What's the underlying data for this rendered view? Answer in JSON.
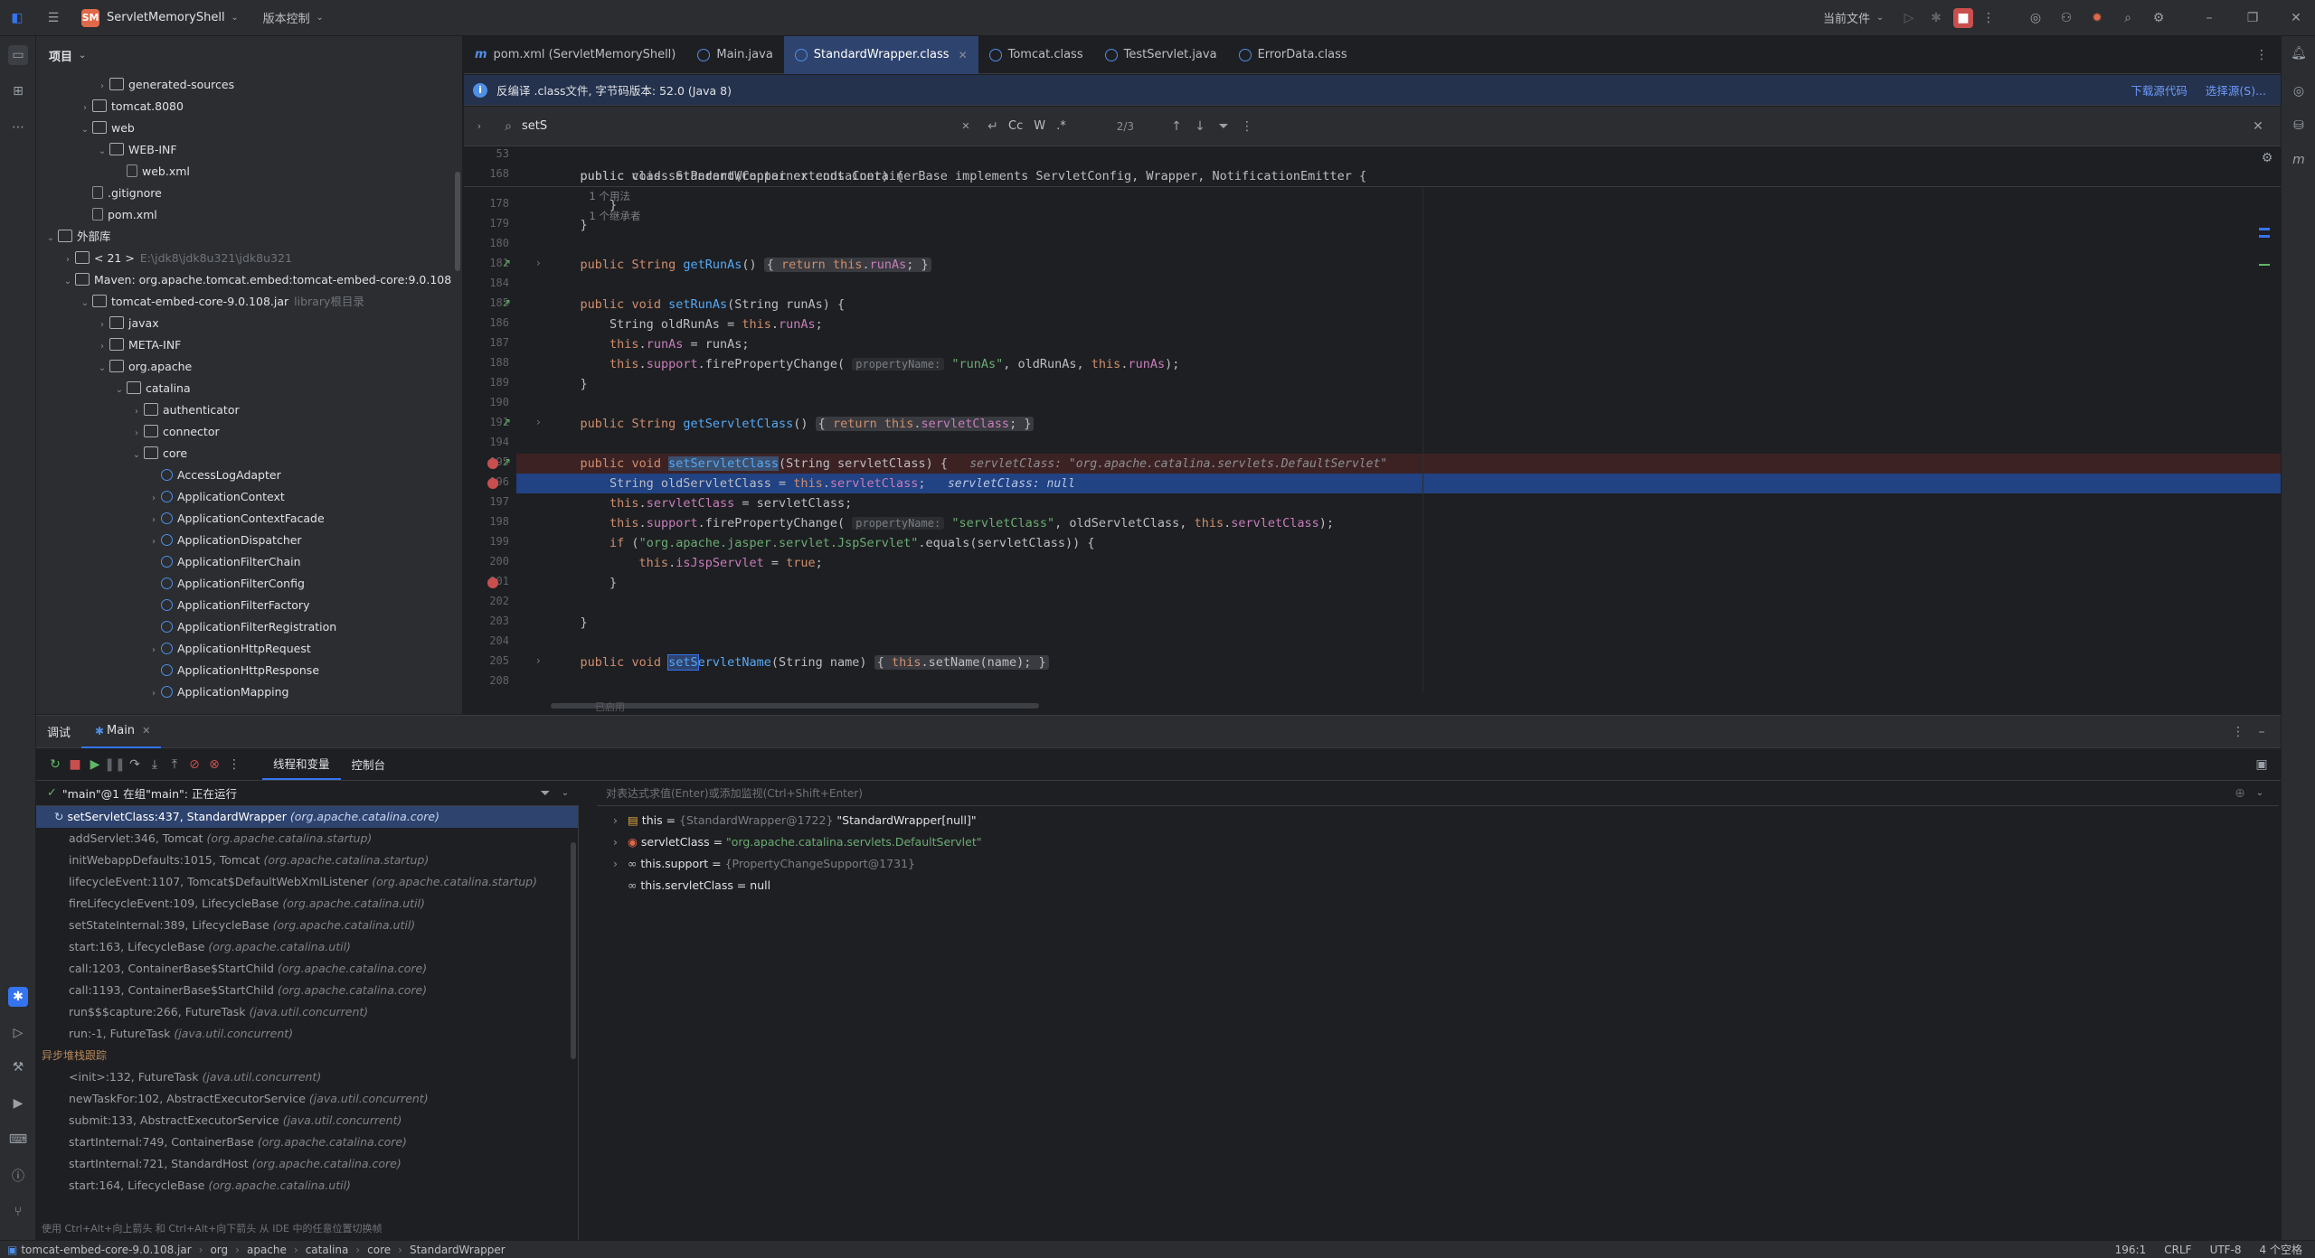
{
  "titlebar": {
    "project_badge": "SM",
    "project_name": "ServletMemoryShell",
    "vcs_label": "版本控制",
    "run_config": "当前文件"
  },
  "project_panel": {
    "title": "项目",
    "items": [
      {
        "label": "generated-sources",
        "depth": 3,
        "type": "folder",
        "arrow": "›"
      },
      {
        "label": "tomcat.8080",
        "depth": 2,
        "type": "folder",
        "arrow": "›"
      },
      {
        "label": "web",
        "depth": 2,
        "type": "folder",
        "arrow": "⌄"
      },
      {
        "label": "WEB-INF",
        "depth": 3,
        "type": "folder",
        "arrow": "⌄"
      },
      {
        "label": "web.xml",
        "depth": 4,
        "type": "file",
        "arrow": ""
      },
      {
        "label": ".gitignore",
        "depth": 2,
        "type": "file",
        "arrow": ""
      },
      {
        "label": "pom.xml",
        "depth": 2,
        "type": "file",
        "arrow": ""
      },
      {
        "label": "外部库",
        "depth": 0,
        "type": "folder",
        "arrow": "⌄"
      },
      {
        "label": "< 21 >",
        "depth": 1,
        "type": "folder",
        "arrow": "›",
        "dim": "E:\\jdk8\\jdk8u321\\jdk8u321"
      },
      {
        "label": "Maven: org.apache.tomcat.embed:tomcat-embed-core:9.0.108",
        "depth": 1,
        "type": "folder",
        "arrow": "⌄"
      },
      {
        "label": "tomcat-embed-core-9.0.108.jar",
        "depth": 2,
        "type": "folder",
        "arrow": "⌄",
        "dim": "library根目录"
      },
      {
        "label": "javax",
        "depth": 3,
        "type": "folder",
        "arrow": "›"
      },
      {
        "label": "META-INF",
        "depth": 3,
        "type": "folder",
        "arrow": "›"
      },
      {
        "label": "org.apache",
        "depth": 3,
        "type": "folder",
        "arrow": "⌄"
      },
      {
        "label": "catalina",
        "depth": 4,
        "type": "folder",
        "arrow": "⌄"
      },
      {
        "label": "authenticator",
        "depth": 5,
        "type": "folder",
        "arrow": "›"
      },
      {
        "label": "connector",
        "depth": 5,
        "type": "folder",
        "arrow": "›"
      },
      {
        "label": "core",
        "depth": 5,
        "type": "folder",
        "arrow": "⌄"
      },
      {
        "label": "AccessLogAdapter",
        "depth": 6,
        "type": "class",
        "arrow": ""
      },
      {
        "label": "ApplicationContext",
        "depth": 6,
        "type": "class",
        "arrow": "›"
      },
      {
        "label": "ApplicationContextFacade",
        "depth": 6,
        "type": "class",
        "arrow": "›"
      },
      {
        "label": "ApplicationDispatcher",
        "depth": 6,
        "type": "class",
        "arrow": "›"
      },
      {
        "label": "ApplicationFilterChain",
        "depth": 6,
        "type": "class",
        "arrow": ""
      },
      {
        "label": "ApplicationFilterConfig",
        "depth": 6,
        "type": "class",
        "arrow": ""
      },
      {
        "label": "ApplicationFilterFactory",
        "depth": 6,
        "type": "class",
        "arrow": ""
      },
      {
        "label": "ApplicationFilterRegistration",
        "depth": 6,
        "type": "class",
        "arrow": ""
      },
      {
        "label": "ApplicationHttpRequest",
        "depth": 6,
        "type": "class",
        "arrow": "›"
      },
      {
        "label": "ApplicationHttpResponse",
        "depth": 6,
        "type": "class",
        "arrow": ""
      },
      {
        "label": "ApplicationMapping",
        "depth": 6,
        "type": "class",
        "arrow": "›"
      }
    ]
  },
  "tabs": [
    {
      "label": "pom.xml (ServletMemoryShell)",
      "icon": "m",
      "active": false
    },
    {
      "label": "Main.java",
      "icon": "c",
      "active": false
    },
    {
      "label": "StandardWrapper.class",
      "icon": "c",
      "active": true
    },
    {
      "label": "Tomcat.class",
      "icon": "c",
      "active": false
    },
    {
      "label": "TestServlet.java",
      "icon": "c",
      "active": false
    },
    {
      "label": "ErrorData.class",
      "icon": "c",
      "active": false
    }
  ],
  "banner": {
    "text": "反编译 .class文件, 字节码版本: 52.0 (Java 8)",
    "download_link": "下载源代码",
    "choose_link": "选择源(S)..."
  },
  "search": {
    "value": "setS",
    "match_count": "2/3",
    "opt_case": "Cc",
    "opt_word": "W",
    "opt_regex": ".*"
  },
  "editor": {
    "sticky_class": "public class StandardWrapper extends ContainerBase implements ServletConfig, Wrapper, NotificationEmitter {",
    "sticky_usage": "1 个用法",
    "sticky_inherit": "1 个继承者",
    "sticky_method": "public void setParent(Container container) {",
    "sticky_num1": "53",
    "sticky_num2": "168",
    "lines": [
      {
        "num": "178",
        "code": "        }"
      },
      {
        "num": "179",
        "code": "    }"
      },
      {
        "num": "180",
        "code": ""
      },
      {
        "num": "181",
        "code": "    public String getRunAs() { return this.runAs; }"
      },
      {
        "num": "184",
        "code": ""
      },
      {
        "num": "185",
        "code": "    public void setRunAs(String runAs) {"
      },
      {
        "num": "186",
        "code": "        String oldRunAs = this.runAs;"
      },
      {
        "num": "187",
        "code": "        this.runAs = runAs;"
      },
      {
        "num": "188",
        "code": "        this.support.firePropertyChange( propertyName: \"runAs\", oldRunAs, this.runAs);"
      },
      {
        "num": "189",
        "code": "    }"
      },
      {
        "num": "190",
        "code": ""
      },
      {
        "num": "191",
        "code": "    public String getServletClass() { return this.servletClass; }"
      },
      {
        "num": "194",
        "code": ""
      },
      {
        "num": "195",
        "code": "    public void setServletClass(String servletClass) {   servletClass: \"org.apache.catalina.servlets.DefaultServlet\""
      },
      {
        "num": "196",
        "code": "        String oldServletClass = this.servletClass;   servletClass: null"
      },
      {
        "num": "197",
        "code": "        this.servletClass = servletClass;"
      },
      {
        "num": "198",
        "code": "        this.support.firePropertyChange( propertyName: \"servletClass\", oldServletClass, this.servletClass);"
      },
      {
        "num": "199",
        "code": "        if (\"org.apache.jasper.servlet.JspServlet\".equals(servletClass)) {"
      },
      {
        "num": "200",
        "code": "            this.isJspServlet = true;"
      },
      {
        "num": "201",
        "code": "        }"
      },
      {
        "num": "202",
        "code": ""
      },
      {
        "num": "203",
        "code": "    }"
      },
      {
        "num": "204",
        "code": ""
      },
      {
        "num": "205",
        "code": "    public void setServletName(String name) { this.setName(name); }"
      },
      {
        "num": "208",
        "code": ""
      }
    ],
    "fragments": {
      "pub": "public",
      "void": "void",
      "string": "String",
      "ret": "return",
      "this": "this",
      "iff": "if",
      "tru": "true",
      "getRunAs": "getRunAs",
      "setRunAs": "setRunAs",
      "getServletClass": "getServletClass",
      "setServletClass": "setServletClass",
      "setServletName_a": "setS",
      "setServletName_b": "ervletName",
      "runAs": "runAs",
      "servletClass": "servletClass",
      "support": "support",
      "isJspServlet": "isJspServlet",
      "propertyName": "propertyName:",
      "str_runAs": "\"runAs\"",
      "str_servletClass": "\"servletClass\"",
      "str_jsp": "\"org.apache.jasper.servlet.JspServlet\"",
      "dbg_195": "servletClass: \"org.apache.catalina.servlets.DefaultServlet\"",
      "dbg_196": "servletClass: null"
    },
    "bottom_hint": "已启用"
  },
  "debug": {
    "tab_debug": "调试",
    "tab_main": "Main",
    "subtab_threads": "线程和变量",
    "subtab_console": "控制台",
    "thread_status": "\"main\"@1 在组\"main\": 正在运行",
    "eval_placeholder": "对表达式求值(Enter)或添加监视(Ctrl+Shift+Enter)",
    "frames": [
      {
        "text": "setServletClass:437, StandardWrapper",
        "pkg": "(org.apache.catalina.core)",
        "selected": true
      },
      {
        "text": "addServlet:346, Tomcat",
        "pkg": "(org.apache.catalina.startup)"
      },
      {
        "text": "initWebappDefaults:1015, Tomcat",
        "pkg": "(org.apache.catalina.startup)"
      },
      {
        "text": "lifecycleEvent:1107, Tomcat$DefaultWebXmlListener",
        "pkg": "(org.apache.catalina.startup)"
      },
      {
        "text": "fireLifecycleEvent:109, LifecycleBase",
        "pkg": "(org.apache.catalina.util)"
      },
      {
        "text": "setStateInternal:389, LifecycleBase",
        "pkg": "(org.apache.catalina.util)"
      },
      {
        "text": "start:163, LifecycleBase",
        "pkg": "(org.apache.catalina.util)"
      },
      {
        "text": "call:1203, ContainerBase$StartChild",
        "pkg": "(org.apache.catalina.core)"
      },
      {
        "text": "call:1193, ContainerBase$StartChild",
        "pkg": "(org.apache.catalina.core)"
      },
      {
        "text": "run$$$capture:266, FutureTask",
        "pkg": "(java.util.concurrent)"
      },
      {
        "text": "run:-1, FutureTask",
        "pkg": "(java.util.concurrent)"
      }
    ],
    "async_header": "异步堆栈跟踪",
    "async_frames": [
      {
        "text": "<init>:132, FutureTask",
        "pkg": "(java.util.concurrent)"
      },
      {
        "text": "newTaskFor:102, AbstractExecutorService",
        "pkg": "(java.util.concurrent)"
      },
      {
        "text": "submit:133, AbstractExecutorService",
        "pkg": "(java.util.concurrent)"
      },
      {
        "text": "startInternal:749, ContainerBase",
        "pkg": "(org.apache.catalina.core)"
      },
      {
        "text": "startInternal:721, StandardHost",
        "pkg": "(org.apache.catalina.core)"
      },
      {
        "text": "start:164, LifecycleBase",
        "pkg": "(org.apache.catalina.util)"
      }
    ],
    "hint_text": "使用 Ctrl+Alt+向上箭头 和 Ctrl+Alt+向下箭头 从 IDE 中的任意位置切换帧",
    "variables": [
      {
        "name": "this",
        "addr": "{StandardWrapper@1722}",
        "value": "\"StandardWrapper[null]\"",
        "expandable": true
      },
      {
        "name": "servletClass",
        "addr": "",
        "value": "\"org.apache.catalina.servlets.DefaultServlet\"",
        "expandable": true
      },
      {
        "name": "this.support",
        "addr": "{PropertyChangeSupport@1731}",
        "value": "",
        "expandable": true
      },
      {
        "name": "this.servletClass",
        "addr": "",
        "value": "null",
        "expandable": false
      }
    ]
  },
  "statusbar": {
    "crumbs": [
      "tomcat-embed-core-9.0.108.jar",
      "org",
      "apache",
      "catalina",
      "core",
      "StandardWrapper"
    ],
    "position": "196:1",
    "line_sep": "CRLF",
    "encoding": "UTF-8",
    "indent": "4 个空格"
  },
  "colors": {
    "accent": "#3574f0",
    "selection": "#2e436e",
    "breakpoint": "#c94f4f"
  }
}
